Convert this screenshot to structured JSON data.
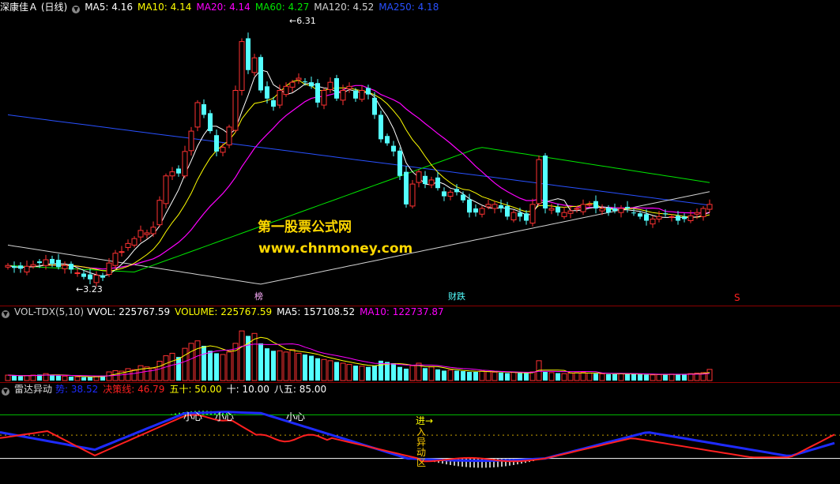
{
  "main": {
    "title": "深康佳Ａ (日线)",
    "ma5": "MA5: 4.16",
    "ma10": "MA10: 4.14",
    "ma20": "MA20: 4.14",
    "ma60": "MA60: 4.27",
    "ma120": "MA120: 4.52",
    "ma250": "MA250: 4.18",
    "high_label": "6.31",
    "low_label": "3.23",
    "marker1": "榜",
    "marker2": "财跌",
    "marker3": "S"
  },
  "watermark": {
    "line1": "第一股票公式网",
    "line2": "www.chnmoney.com"
  },
  "volume": {
    "title": "VOL-TDX(5,10)",
    "vvol": "VVOL: 225767.59",
    "volume": "VOLUME: 225767.59",
    "ma5": "MA5: 157108.52",
    "ma10": "MA10: 122737.87"
  },
  "indicator": {
    "title": "雷达异动",
    "v1": "势: 38.52",
    "v2": "决策线: 46.79",
    "v3": "五十: 50.00",
    "v4": "十: 10.00",
    "v5": "八五: 85.00",
    "label_xiaoxin": "小心",
    "label_jin": "进→",
    "label_zone": [
      "入",
      "异",
      "动",
      "区"
    ]
  },
  "colors": {
    "up": "#ff3232",
    "down": "#54ffff",
    "ma5": "#ffffff",
    "ma10": "#ffff00",
    "ma20": "#ff00ff",
    "ma60": "#00e600",
    "ma120": "#d2d2d2",
    "ma250": "#2850ff",
    "line_blue": "#1e2bff",
    "line_red": "#ff2020",
    "green_bar": "#22ee22"
  },
  "chart_data": [
    {
      "type": "candlestick",
      "title": "深康佳Ａ (日线)",
      "x": [
        1,
        2,
        3,
        4,
        5,
        6,
        7,
        8,
        9,
        10,
        11,
        12,
        13,
        14,
        15,
        16,
        17,
        18,
        19,
        20,
        21,
        22,
        23,
        24,
        25,
        26,
        27,
        28,
        29,
        30,
        31,
        32,
        33,
        34,
        35,
        36,
        37,
        38,
        39,
        40,
        41,
        42,
        43,
        44,
        45,
        46,
        47,
        48,
        49,
        50,
        51,
        52,
        53,
        54,
        55,
        56,
        57,
        58,
        59,
        60,
        61,
        62,
        63,
        64,
        65,
        66,
        67,
        68,
        69,
        70,
        71,
        72,
        73,
        74,
        75,
        76,
        77,
        78,
        79,
        80,
        81,
        82,
        83,
        84,
        85,
        86,
        87,
        88,
        89,
        90,
        91,
        92,
        93,
        94,
        95,
        96,
        97,
        98,
        99,
        100,
        101,
        102,
        103,
        104,
        105,
        106,
        107,
        108,
        109,
        110,
        111,
        112,
        113,
        114,
        115,
        116,
        117,
        118,
        119,
        120,
        121,
        122,
        123,
        124,
        125,
        126,
        127,
        128,
        129,
        130,
        131,
        132
      ],
      "close": [
        3.45,
        3.42,
        3.41,
        3.44,
        3.46,
        3.48,
        3.52,
        3.47,
        3.43,
        3.45,
        3.4,
        3.36,
        3.31,
        3.28,
        3.33,
        3.3,
        3.48,
        3.6,
        3.62,
        3.72,
        3.78,
        3.88,
        3.85,
        3.92,
        4.25,
        4.55,
        4.6,
        4.58,
        4.85,
        5.1,
        5.45,
        5.3,
        5.1,
        4.85,
        4.9,
        5.15,
        5.6,
        6.2,
        5.85,
        6.0,
        5.6,
        5.5,
        5.4,
        5.6,
        5.65,
        5.7,
        5.75,
        5.7,
        5.65,
        5.45,
        5.6,
        5.7,
        5.5,
        5.6,
        5.65,
        5.5,
        5.6,
        5.55,
        5.3,
        5.0,
        4.95,
        4.85,
        4.55,
        4.2,
        4.45,
        4.6,
        4.45,
        4.5,
        4.4,
        4.3,
        4.35,
        4.35,
        4.25,
        4.1,
        4.1,
        4.15,
        4.2,
        4.2,
        4.15,
        4.05,
        4.1,
        4.05,
        4.0,
        4.2,
        4.75,
        4.15,
        4.15,
        4.1,
        4.1,
        4.12,
        4.15,
        4.2,
        4.2,
        4.15,
        4.15,
        4.1,
        4.12,
        4.15,
        4.15,
        4.1,
        4.05,
        4.0,
        4.02,
        4.05,
        4.08,
        4.05,
        4.0,
        4.02,
        4.06,
        4.1,
        4.15,
        4.2
      ],
      "ylim": [
        3.0,
        6.5
      ],
      "annotations": [
        "6.31",
        "3.23",
        "榜",
        "财跌",
        "S"
      ],
      "series": [
        {
          "name": "MA5",
          "last": 4.16
        },
        {
          "name": "MA10",
          "last": 4.14
        },
        {
          "name": "MA20",
          "last": 4.14
        },
        {
          "name": "MA60",
          "last": 4.27
        },
        {
          "name": "MA120",
          "last": 4.52
        },
        {
          "name": "MA250",
          "last": 4.18
        }
      ]
    },
    {
      "type": "bar",
      "title": "VOL-TDX(5,10)",
      "values": [
        22,
        20,
        18,
        20,
        22,
        24,
        28,
        22,
        20,
        18,
        16,
        15,
        14,
        14,
        18,
        20,
        35,
        40,
        38,
        48,
        44,
        60,
        55,
        50,
        78,
        100,
        110,
        95,
        130,
        150,
        160,
        140,
        120,
        110,
        105,
        115,
        150,
        200,
        180,
        190,
        150,
        130,
        120,
        120,
        115,
        125,
        110,
        105,
        100,
        90,
        85,
        80,
        75,
        70,
        65,
        60,
        58,
        55,
        60,
        80,
        75,
        70,
        55,
        48,
        60,
        70,
        50,
        55,
        45,
        40,
        42,
        40,
        38,
        35,
        35,
        38,
        36,
        34,
        32,
        30,
        33,
        30,
        30,
        35,
        80,
        35,
        32,
        30,
        28,
        30,
        32,
        33,
        30,
        28,
        27,
        26,
        26,
        28,
        27,
        26,
        25,
        24,
        23,
        24,
        25,
        26,
        25,
        27,
        28,
        30,
        32,
        45
      ],
      "lines": [
        {
          "name": "MA5",
          "last": 157108.52
        },
        {
          "name": "MA10",
          "last": 122737.87
        }
      ]
    },
    {
      "type": "line",
      "title": "雷达异动",
      "ylim": [
        -5,
        105
      ],
      "series": [
        {
          "name": "势",
          "last": 38.52
        },
        {
          "name": "决策线",
          "last": 46.79
        },
        {
          "name": "五十",
          "value": 50.0
        },
        {
          "name": "十",
          "value": 10.0
        },
        {
          "name": "八五",
          "value": 85.0
        }
      ]
    }
  ]
}
